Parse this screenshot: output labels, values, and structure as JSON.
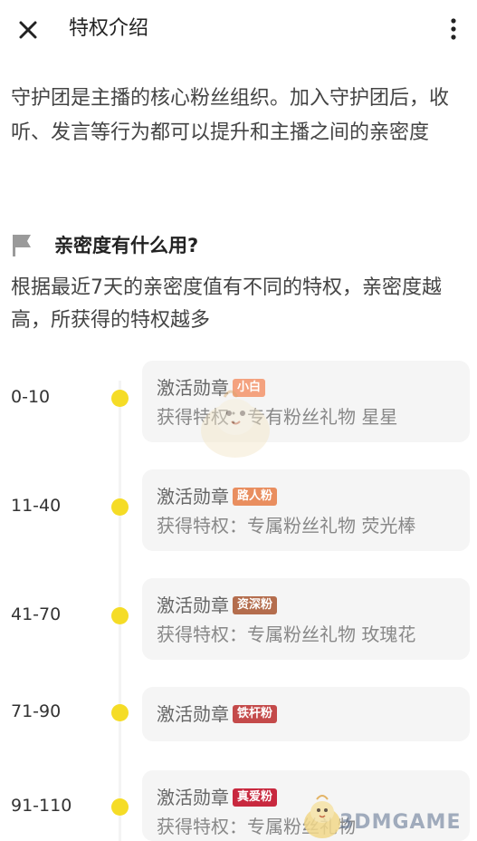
{
  "header": {
    "title": "特权介绍",
    "close_icon": "close-icon",
    "more_icon": "more-vertical-icon"
  },
  "intro": "守护团是主播的核心粉丝组织。加入守护团后，收听、发言等行为都可以提升和主播之间的亲密度",
  "section": {
    "icon": "flag-icon",
    "title": "亲密度有什么用?",
    "description": "根据最近7天的亲密度值有不同的特权，亲密度越高，所获得的特权越多"
  },
  "timeline": [
    {
      "range": "0-10",
      "activate": "激活勋章",
      "badge": "小白",
      "badge_color": "#f4a27f",
      "privilege": "获得特权：专有粉丝礼物 星星"
    },
    {
      "range": "11-40",
      "activate": "激活勋章",
      "badge": "路人粉",
      "badge_color": "#e98e5f",
      "privilege": "获得特权：专属粉丝礼物 荧光棒"
    },
    {
      "range": "41-70",
      "activate": "激活勋章",
      "badge": "资深粉",
      "badge_color": "#b46d4d",
      "privilege": "获得特权：专属粉丝礼物 玫瑰花"
    },
    {
      "range": "71-90",
      "activate": "激活勋章",
      "badge": "铁杆粉",
      "badge_color": "#c44a4a",
      "privilege": ""
    },
    {
      "range": "91-110",
      "activate": "激活勋章",
      "badge": "真爱粉",
      "badge_color": "#c8283e",
      "privilege": "获得特权：专属粉丝礼物"
    }
  ],
  "watermark": "3DMGAME",
  "colors": {
    "dot": "#f5dc26",
    "card_bg": "#f5f5f5"
  }
}
